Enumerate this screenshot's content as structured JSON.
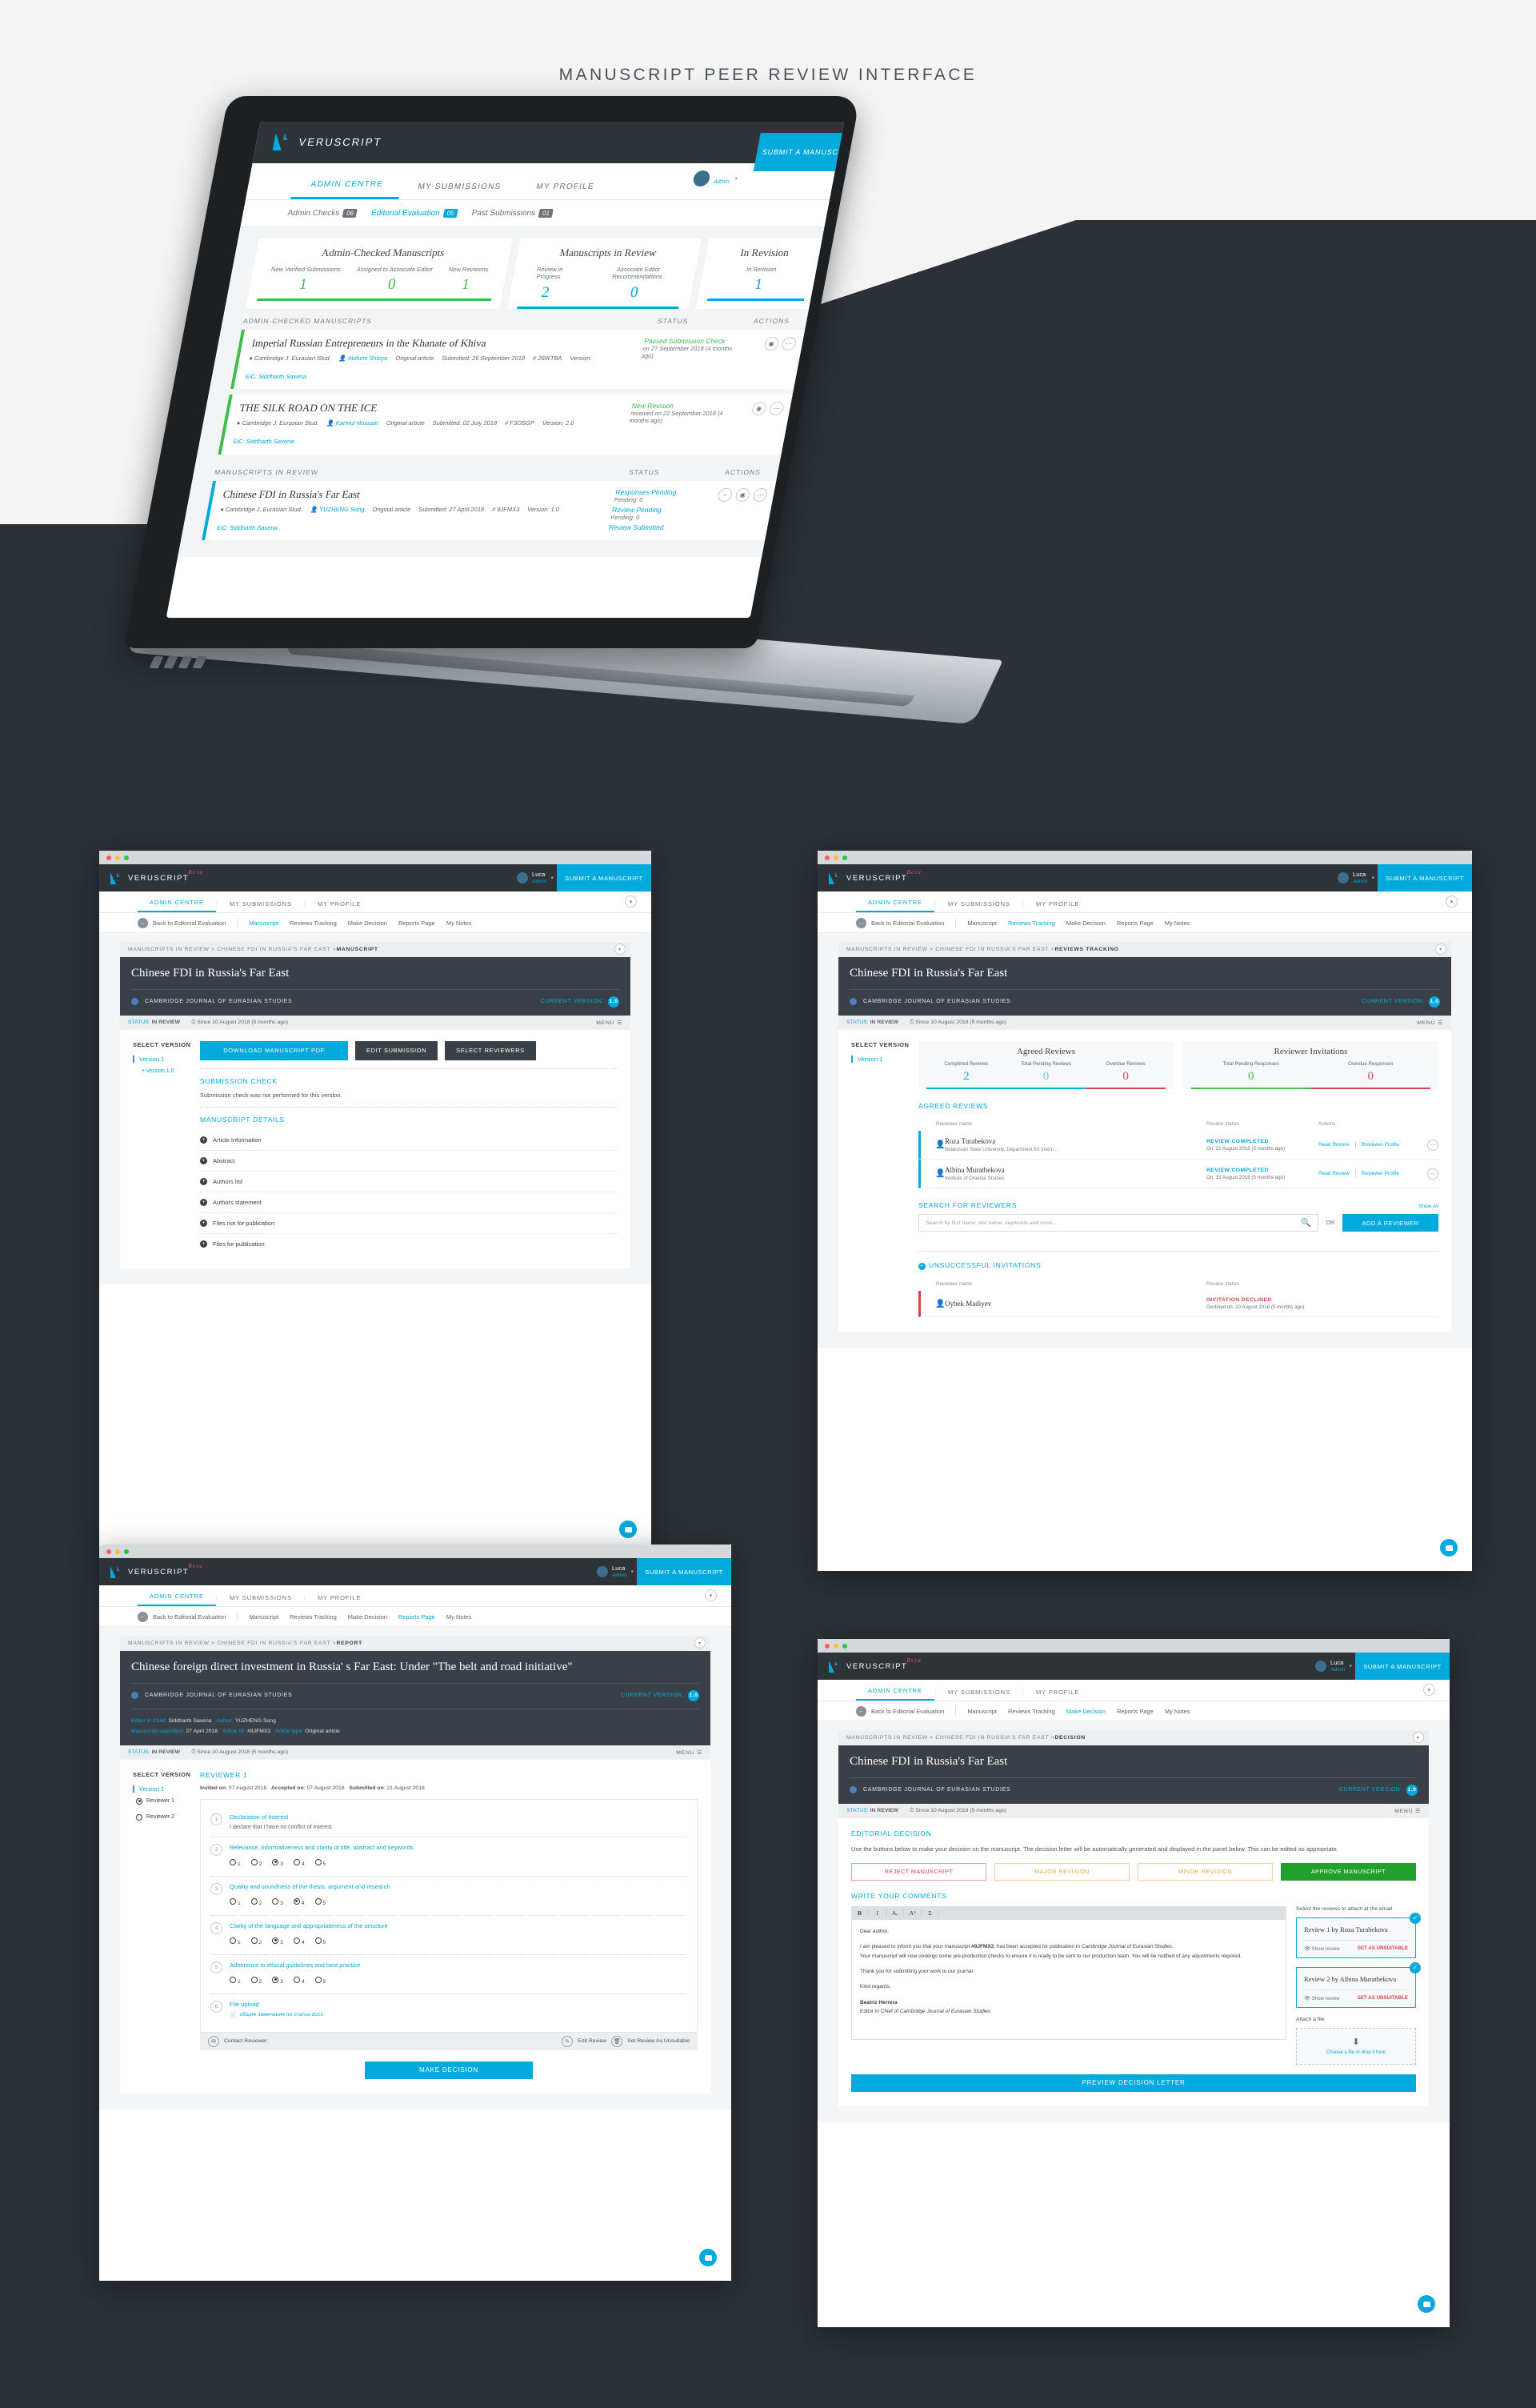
{
  "page_title": "MANUSCRIPT PEER REVIEW INTERFACE",
  "brand": {
    "name": "VERUSCRIPT",
    "beta": "Beta"
  },
  "user": {
    "name": "Luca",
    "role": "Admin"
  },
  "submit_cta": "SUBMIT A MANUSCRIPT",
  "main_nav": [
    {
      "label": "ADMIN CENTRE",
      "active": true
    },
    {
      "label": "MY SUBMISSIONS",
      "active": false
    },
    {
      "label": "MY PROFILE",
      "active": false
    }
  ],
  "laptop": {
    "sub_nav": [
      {
        "label": "Admin Checks",
        "count": "06",
        "active": false
      },
      {
        "label": "Editorial Evaluation",
        "count": "05",
        "active": true
      },
      {
        "label": "Past Submissions",
        "count": "01",
        "active": false
      }
    ],
    "stat_cards": [
      {
        "title": "Admin-Checked Manuscripts",
        "color": "#3fbd4a",
        "items": [
          {
            "label": "New Verified Submissions",
            "value": "1"
          },
          {
            "label": "Assigned to Associate Editor",
            "value": "0"
          },
          {
            "label": "New Revisions",
            "value": "1"
          }
        ]
      },
      {
        "title": "Manuscripts in Review",
        "color": "#00aadc",
        "items": [
          {
            "label": "Review in Progress",
            "value": "2"
          },
          {
            "label": "Associate Editor Recommendations",
            "value": "0"
          }
        ]
      },
      {
        "title": "In Revision",
        "color": "#00aadc",
        "items": [
          {
            "label": "In Revision",
            "value": "1"
          }
        ]
      }
    ],
    "sections": [
      {
        "heading": "ADMIN-CHECKED MANUSCRIPTS",
        "col_status": "STATUS",
        "col_actions": "ACTIONS",
        "rows": [
          {
            "title": "Imperial Russian Entrepreneurs in the Khanate of Khiva",
            "journal": "Cambridge J. Eurasian Stud.",
            "author": "Akifumi Shioya",
            "type": "Original article",
            "submitted": "Submitted: 26 September 2018",
            "id": "26WTBA",
            "version": "Version:",
            "eic": "EiC: Siddharth Saxena",
            "status": "Passed Submission Check",
            "status_date": "on 27 September 2018 (4 months ago)"
          },
          {
            "title": "THE SILK ROAD ON THE ICE",
            "journal": "Cambridge J. Eurasian Stud.",
            "author": "Kamrul Hossain",
            "type": "Original article",
            "submitted": "Submitted: 02 July 2018",
            "id": "F3OSGP",
            "version": "Version: 2.0",
            "eic": "EiC: Siddharth Saxena",
            "status": "New Revision",
            "status_date": "received on 22 September 2018 (4 months ago)"
          }
        ]
      },
      {
        "heading": "MANUSCRIPTS IN REVIEW",
        "col_status": "STATUS",
        "col_actions": "ACTIONS",
        "rows": [
          {
            "title": "Chinese FDI in Russia's Far East",
            "journal": "Cambridge J. Eurasian Stud.",
            "author": "YUZHENG Song",
            "type": "Original article",
            "submitted": "Submitted: 27 April 2018",
            "id": "9JFMX3",
            "version": "Version: 1.0",
            "eic": "EiC: Siddharth Saxena",
            "status": "Responses Pending",
            "status_date": "Pending: 0",
            "status2": "Review Pending",
            "status2_date": "Pending: 0",
            "status3": "Review Submitted"
          }
        ]
      }
    ]
  },
  "panel1": {
    "sub_nav": [
      {
        "label": "Back to Editorial Evaluation"
      },
      {
        "label": "Manuscript",
        "active": true
      },
      {
        "label": "Reviews Tracking"
      },
      {
        "label": "Make Decision"
      },
      {
        "label": "Reports Page"
      },
      {
        "label": "My Notes"
      }
    ],
    "breadcrumb": "MANUSCRIPTS IN REVIEW  >  CHINESE FDI IN RUSSIA'S FAR EAST  >  ",
    "breadcrumb_current": "MANUSCRIPT",
    "title": "Chinese FDI in Russia's Far East",
    "journal": "CAMBRIDGE JOURNAL OF EURASIAN STUDIES",
    "version_label": "CURRENT VERSION:",
    "version_value": "1.0",
    "status_key": "STATUS:",
    "status_value": "IN REVIEW",
    "status_since": "Since 10 August 2018 (5 months ago)",
    "menu": "MENU",
    "select_version": "SELECT VERSION",
    "version_1": "Version 1",
    "version_1_0": "Version 1.0",
    "buttons": [
      {
        "label": "DOWNLOAD MANUSCRIPT PDF",
        "style": "cy"
      },
      {
        "label": "EDIT SUBMISSION",
        "style": "dk"
      },
      {
        "label": "SELECT REVIEWERS",
        "style": "dk"
      }
    ],
    "submission_check_title": "SUBMISSION CHECK",
    "submission_check_text": "Submission check was not performed for this version.",
    "details_title": "MANUSCRIPT DETAILS",
    "details": [
      "Article Information",
      "Abstract",
      "Authors list",
      "Authors statement",
      "Files not for publication",
      "Files for publication"
    ]
  },
  "panel2": {
    "sub_nav": [
      {
        "label": "Back to Editorial Evaluation"
      },
      {
        "label": "Manuscript"
      },
      {
        "label": "Reviews Tracking",
        "active": true
      },
      {
        "label": "Make Decision"
      },
      {
        "label": "Reports Page"
      },
      {
        "label": "My Notes"
      }
    ],
    "breadcrumb": "MANUSCRIPTS IN REVIEW  >  CHINESE FDI IN RUSSIA'S FAR EAST  >  ",
    "breadcrumb_current": "REVIEWS TRACKING",
    "title": "Chinese FDI in Russia's Far East",
    "journal": "CAMBRIDGE JOURNAL OF EURASIAN STUDIES",
    "version_label": "CURRENT VERSION:",
    "version_value": "1.0",
    "status_key": "STATUS:",
    "status_value": "IN REVIEW",
    "status_since": "Since 10 August 2018 (5 months ago)",
    "menu": "MENU",
    "select_version": "SELECT VERSION",
    "version_1": "Version 1",
    "stats": [
      {
        "title": "Agreed Reviews",
        "items": [
          {
            "label": "Completed Reviews",
            "value": "2",
            "color": "#00aadc"
          },
          {
            "label": "Total Pending Reviews",
            "value": "0",
            "color": "#6fc8e8"
          },
          {
            "label": "Overdue Reviews",
            "value": "0",
            "color": "#d8434b"
          }
        ],
        "bar": [
          {
            "color": "#00aadc",
            "flex": 2
          },
          {
            "color": "#d8434b",
            "flex": 1
          }
        ]
      },
      {
        "title": "Reviewer Invitations",
        "items": [
          {
            "label": "Total Pending Responses",
            "value": "0",
            "color": "#3fbd4a"
          },
          {
            "label": "Overdue Responses",
            "value": "0",
            "color": "#d8434b"
          }
        ],
        "bar": [
          {
            "color": "#3fbd4a",
            "flex": 1
          },
          {
            "color": "#d8434b",
            "flex": 1
          }
        ]
      }
    ],
    "agreed_title": "AGREED REVIEWS",
    "col_name": "Reviewer name",
    "col_status": "Review status",
    "col_actions": "Actions",
    "reviewers": [
      {
        "name": "Roza Turabekova",
        "affiliation": "Belarusian State University, Department for Intern...",
        "status": "REVIEW COMPLETED",
        "date": "On: 21 August 2018 (5 months ago)",
        "action1": "Read Review",
        "action2": "Reviewer Profile"
      },
      {
        "name": "Albina Muratbekova",
        "affiliation": "Institute of Oriental Studies",
        "status": "REVIEW COMPLETED",
        "date": "On: 15 August 2018 (5 months ago)",
        "action1": "Read Review",
        "action2": "Reviewer Profile"
      }
    ],
    "search_title": "SEARCH FOR REVIEWERS",
    "show_all": "Show All",
    "search_placeholder": "Search by first name, last name, keywords and more...",
    "or_label": "OR",
    "add_reviewer": "ADD A REVIEWER",
    "unsuccessful_title": "UNSUCCESSFUL INVITATIONS",
    "unsuccessful": [
      {
        "name": "Oybek Madiyev",
        "status": "INVITATION DECLINED",
        "date": "Declined on: 10 August 2018 (5 months ago)"
      }
    ]
  },
  "panel3": {
    "sub_nav": [
      {
        "label": "Back to Editorial Evaluation"
      },
      {
        "label": "Manuscript"
      },
      {
        "label": "Reviews Tracking"
      },
      {
        "label": "Make Decision"
      },
      {
        "label": "Reports Page",
        "active": true
      },
      {
        "label": "My Notes"
      }
    ],
    "breadcrumb": "MANUSCRIPTS IN REVIEW  >  CHINESE FDI IN RUSSIA'S FAR EAST  >  ",
    "breadcrumb_current": "REPORT",
    "title": "Chinese foreign direct investment in Russia' s Far East: Under \"The belt and road initiative\"",
    "journal": "CAMBRIDGE JOURNAL OF EURASIAN STUDIES",
    "version_label": "CURRENT VERSION:",
    "version_value": "1.0",
    "meta": [
      {
        "k": "Editor in Chief:",
        "v": "Siddharth Saxena"
      },
      {
        "k": "Author:",
        "v": "YUZHENG Song"
      }
    ],
    "meta2": [
      {
        "k": "Manuscript submitted:",
        "v": "27 April 2018"
      },
      {
        "k": "Article ID:",
        "v": "#9JFMX3"
      },
      {
        "k": "Article type:",
        "v": "Original article"
      }
    ],
    "status_key": "STATUS:",
    "status_value": "IN REVIEW",
    "status_since": "Since 10 August 2018 (5 months ago)",
    "menu": "MENU",
    "select_version": "SELECT VERSION",
    "version_1": "Version 1",
    "reviewer_choices": [
      {
        "label": "Reviewer 1",
        "selected": true
      },
      {
        "label": "Reviewer 2",
        "selected": false
      }
    ],
    "reviewer_title": "REVIEWER 1",
    "dates": [
      {
        "k": "Invited on",
        "v": "07 August 2018"
      },
      {
        "k": "Accepted on",
        "v": "07 August 2018"
      },
      {
        "k": "Submitted on",
        "v": "21 August 2018"
      }
    ],
    "questions": [
      {
        "n": "1",
        "title": "Declaration of Interest",
        "answer": "I declare that I have no conflict of interest"
      },
      {
        "n": "2",
        "title": "Relevance, informativeness and clarity of title, abstract and keywords",
        "scale": 3
      },
      {
        "n": "3",
        "title": "Quality and soundness of the thesis, argument and research",
        "scale": 4
      },
      {
        "n": "4",
        "title": "Clarity of the language and appropriateness of the structure",
        "scale": 3
      },
      {
        "n": "5",
        "title": "Adherence to ethical guidelines and best practice",
        "scale": 3
      },
      {
        "n": "6",
        "title": "File upload",
        "file": "общие замечания по статье.docx"
      }
    ],
    "footer_actions": [
      {
        "label": "Contact Reviewer",
        "icon": "envelope-icon"
      },
      {
        "label": "Edit Review",
        "icon": "pencil-icon"
      },
      {
        "label": "Set Review As Unsuitable",
        "icon": "trash-icon"
      }
    ],
    "make_decision": "MAKE DECISION"
  },
  "panel4": {
    "sub_nav": [
      {
        "label": "Back to Editorial Evaluation"
      },
      {
        "label": "Manuscript"
      },
      {
        "label": "Reviews Tracking"
      },
      {
        "label": "Make Decision",
        "active": true
      },
      {
        "label": "Reports Page"
      },
      {
        "label": "My Notes"
      }
    ],
    "breadcrumb": "MANUSCRIPTS IN REVIEW  >  CHINESE FDI IN RUSSIA'S FAR EAST  >  ",
    "breadcrumb_current": "DECISION",
    "title": "Chinese FDI in Russia's Far East",
    "journal": "CAMBRIDGE JOURNAL OF EURASIAN STUDIES",
    "version_label": "CURRENT VERSION:",
    "version_value": "1.0",
    "status_key": "STATUS:",
    "status_value": "IN REVIEW",
    "status_since": "Since 10 August 2018 (5 months ago)",
    "menu": "MENU",
    "decision_title": "EDITORIAL DECISION",
    "decision_text": "Use the buttons below to make your decision on the manuscript. The decision letter will be automatically generated and displayed in the panel below. This can be edited as appropriate.",
    "decision_buttons": [
      {
        "label": "REJECT MANUSCRIPT",
        "style": "rej"
      },
      {
        "label": "MAJOR REVISION",
        "style": "maj"
      },
      {
        "label": "MINOR REVISION",
        "style": "min"
      },
      {
        "label": "APPROVE MANUSCRIPT",
        "style": "app"
      }
    ],
    "comments_title": "WRITE YOUR COMMENTS",
    "toolbar": [
      "B",
      "I",
      "Aₑ",
      "A²",
      "Σ"
    ],
    "letter": {
      "greeting": "Dear author,",
      "p1_a": "I am pleased to inform you that your manuscript ",
      "p1_id": "#9JFMX3",
      "p1_b": ", has been accepted for publication in ",
      "p1_journal": "Cambridge Journal of Eurasian Studies",
      "p1_c": ".",
      "p2": "Your manuscript will now undergo some pre-production checks to ensure it is ready to be sent to our production team. You will be notified of any adjustments required.",
      "p3": "Thank you for submitting your work to our journal.",
      "p4": "Kind regards,",
      "sig_name": "Beatriz Herrera",
      "sig_role_a": "Editor in Chief of ",
      "sig_role_b": "Cambridge Journal of Eurasian Studies"
    },
    "attach_label": "Select the reviews to attach at the email",
    "reviews": [
      {
        "title": "Review 1 by Roza Turabekova",
        "show": "Show review",
        "unsuitable": "SET AS UNSUITABLE",
        "checked": true
      },
      {
        "title": "Review 2 by Albina Muratbekova",
        "show": "Show review",
        "unsuitable": "SET AS UNSUITABLE",
        "checked": true
      }
    ],
    "attach_file_label": "Attach a file",
    "dropzone": "Choose a file or drop it here",
    "preview_button": "PREVIEW DECISION LETTER"
  }
}
